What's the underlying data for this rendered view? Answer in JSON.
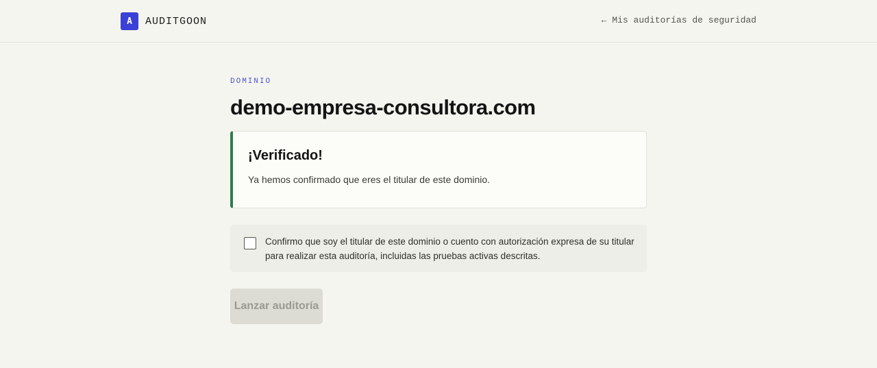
{
  "header": {
    "logo_letter": "A",
    "brand_name": "AUDITGOON",
    "back_link": "← Mis auditorías de seguridad"
  },
  "main": {
    "eyebrow": "DOMINIO",
    "domain": "demo-empresa-consultora.com",
    "verified": {
      "title": "¡Verificado!",
      "message": "Ya hemos confirmado que eres el titular de este dominio."
    },
    "consent": {
      "checked": false,
      "text": "Confirmo que soy el titular de este dominio o cuento con autorización expresa de su titular para realizar esta auditoría, incluidas las pruebas activas descritas."
    },
    "launch_button": {
      "label": "Lanzar auditoría",
      "disabled": true
    }
  },
  "colors": {
    "accent": "#3b40d6",
    "success": "#2e7d4f",
    "background": "#f5f5f0"
  }
}
